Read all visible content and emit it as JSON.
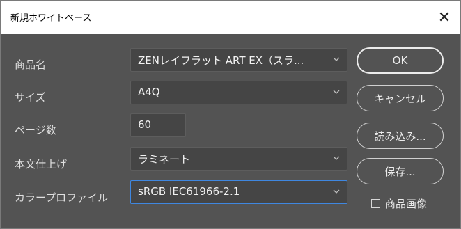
{
  "window": {
    "title": "新規ホワイトベース",
    "close_glyph": "✕"
  },
  "fields": [
    {
      "label": "商品名",
      "value": "ZENレイフラット ART EX（スラ..."
    },
    {
      "label": "サイズ",
      "value": "A4Q"
    },
    {
      "label": "ページ数",
      "value": "60"
    },
    {
      "label": "本文仕上げ",
      "value": "ラミネート"
    },
    {
      "label": "カラープロファイル",
      "value": "sRGB IEC61966-2.1"
    }
  ],
  "buttons": {
    "ok": "OK",
    "cancel": "キャンセル",
    "load": "読み込み...",
    "save": "保存..."
  },
  "checkbox": {
    "label": "商品画像",
    "checked": false
  },
  "colors": {
    "dialog_bg": "#535353",
    "field_bg": "#454545",
    "focus_border": "#3f87e0"
  },
  "icons": {
    "dropdown": "chevron-down-icon",
    "close": "close-icon"
  }
}
